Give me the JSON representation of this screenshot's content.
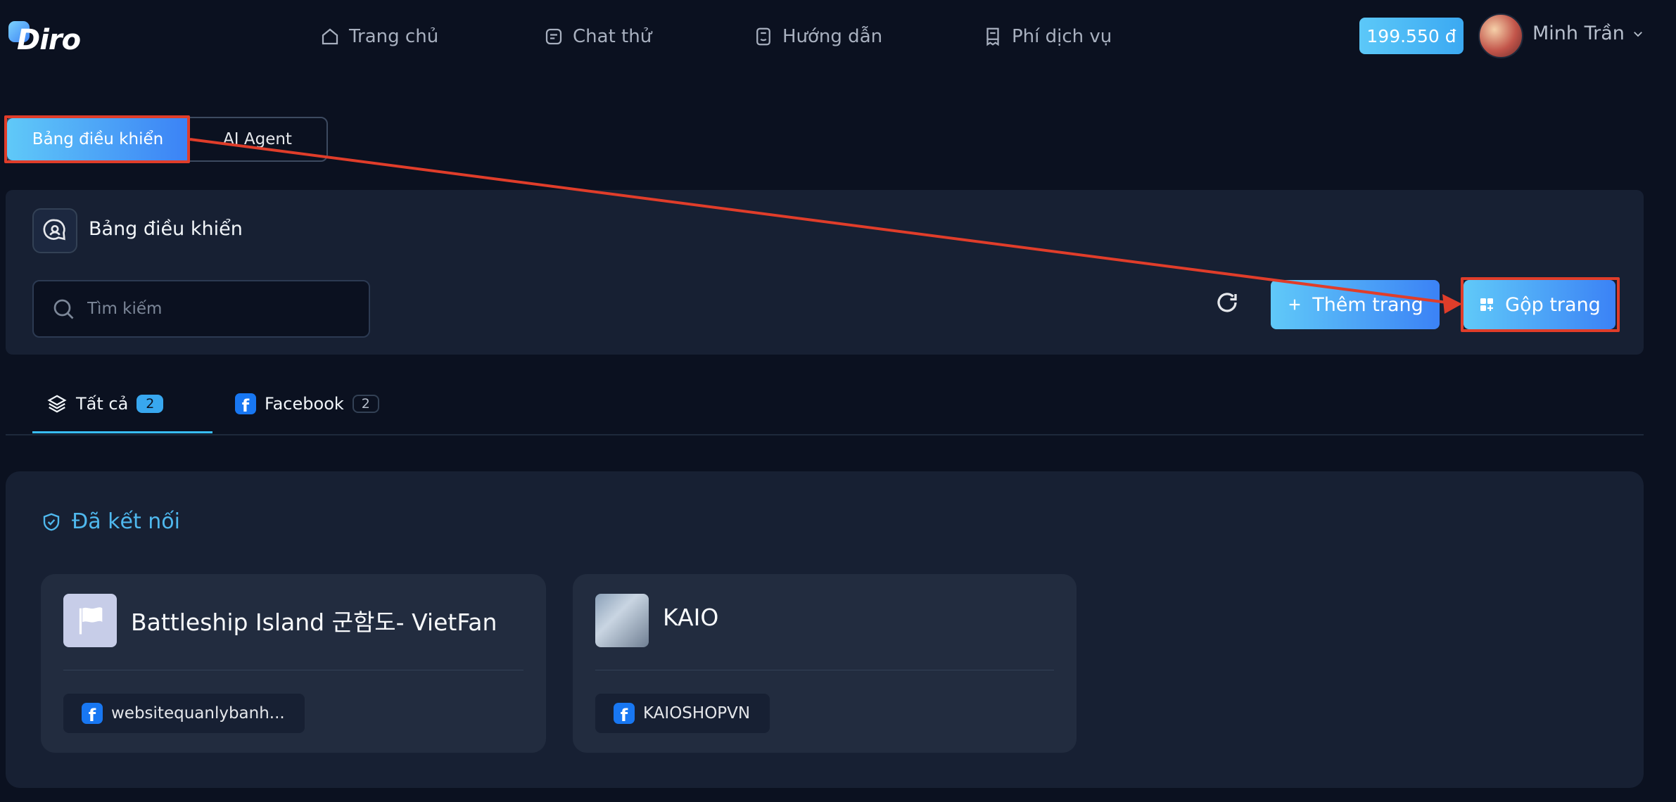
{
  "header": {
    "logo": "Diro",
    "nav": [
      {
        "label": "Trang chủ",
        "icon": "home-icon"
      },
      {
        "label": "Chat thử",
        "icon": "chat-icon"
      },
      {
        "label": "Hướng dẫn",
        "icon": "guide-icon"
      },
      {
        "label": "Phí dịch vụ",
        "icon": "receipt-icon"
      }
    ],
    "balance": "199.550 đ",
    "user_name": "Minh Trần"
  },
  "top_tabs": [
    {
      "label": "Bảng điều khiển",
      "active": true
    },
    {
      "label": "AI Agent",
      "active": false
    }
  ],
  "panel": {
    "title": "Bảng điều khiển",
    "search_placeholder": "Tìm kiếm",
    "add_label": "Thêm trang",
    "merge_label": "Gộp trang"
  },
  "filter_tabs": [
    {
      "label": "Tất cả",
      "count": "2",
      "icon": "layers-icon",
      "active": true
    },
    {
      "label": "Facebook",
      "count": "2",
      "icon": "facebook-icon",
      "active": false
    }
  ],
  "connected": {
    "title": "Đã kết nối",
    "cards": [
      {
        "name": "Battleship Island 군함도- VietFan",
        "account": "websitequanlybanh...",
        "icon": "flag-icon"
      },
      {
        "name": "KAIO",
        "account": "KAIOSHOPVN",
        "icon": "page-avatar"
      }
    ]
  },
  "colors": {
    "background": "#0b1120",
    "panel": "#172033",
    "accent_start": "#60c9f8",
    "accent_end": "#3b82f6",
    "annotation": "#e03d2a"
  }
}
